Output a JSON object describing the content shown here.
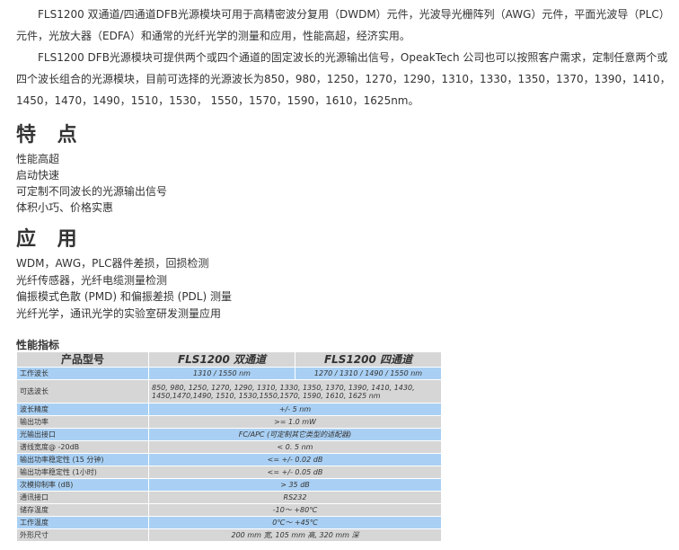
{
  "intro": {
    "p1": "FLS1200 双通道/四通道DFB光源模块可用于高精密波分复用（DWDM）元件，光波导光栅阵列（AWG）元件，平面光波导（PLC）元件，光放大器（EDFA）和通常的光纤光学的测量和应用，性能高超，经济实用。",
    "p2": "FLS1200 DFB光源模块可提供两个或四个通道的固定波长的光源输出信号，OpeakTech 公司也可以按照客户需求，定制任意两个或四个波长组合的光源模块，目前可选择的光源波长为850，980，1250，1270，1290，1310，1330，1350，1370，1390，1410，1450，1470，1490，1510，1530， 1550，1570，1590，1610，1625nm。"
  },
  "features": {
    "heading": "特 点",
    "items": [
      "性能高超",
      "启动快速",
      "可定制不同波长的光源输出信号",
      "体积小巧、价格实惠"
    ]
  },
  "applications": {
    "heading": "应 用",
    "items": [
      "WDM，AWG，PLC器件差损，回损检测",
      "光纤传感器，光纤电缆测量检测",
      "偏振模式色散 (PMD) 和偏振差损 (PDL) 测量",
      "光纤光学，通讯光学的实验室研发测量应用"
    ]
  },
  "spec": {
    "title": "性能指标",
    "header": [
      "产品型号",
      "FLS1200 双通道",
      "FLS1200 四通道"
    ],
    "rows": [
      {
        "label": "工作波长",
        "v1": "1310 / 1550 nm",
        "v2": "1270 / 1310 / 1490 / 1550 nm",
        "hl": true
      },
      {
        "label": "可选波长",
        "multi": "850, 980, 1250, 1270, 1290, 1310, 1330, 1350, 1370, 1390, 1410, 1430, 1450,1470,1490, 1510, 1530,1550,1570, 1590, 1610, 1625 nm",
        "hl": false,
        "tall": true
      },
      {
        "label": "波长精度",
        "value": "+/- 5 nm",
        "hl": true
      },
      {
        "label": "输出功率",
        "value": ">= 1.0 mW",
        "hl": false
      },
      {
        "label": "光输出接口",
        "value": "FC/APC (可定制其它类型的适配器)",
        "hl": true
      },
      {
        "label": "谱线宽度@ -20dB",
        "value": "< 0. 5 nm",
        "hl": false
      },
      {
        "label": "输出功率稳定性 (15 分钟)",
        "value": "<= +/- 0.02 dB",
        "hl": true
      },
      {
        "label": "输出功率稳定性 (1小时)",
        "value": "<= +/- 0.05 dB",
        "hl": false
      },
      {
        "label": "次模抑制率 (dB)",
        "value": "> 35 dB",
        "hl": true
      },
      {
        "label": "通讯接口",
        "value": "RS232",
        "hl": false
      },
      {
        "label": "储存温度",
        "value": "-10～ +80℃",
        "hl": false
      },
      {
        "label": "工作温度",
        "value": "0℃～ +45℃",
        "hl": true
      },
      {
        "label": "外形尺寸",
        "value": "200 mm 宽, 105 mm 高, 320 mm 深",
        "hl": false
      }
    ]
  }
}
